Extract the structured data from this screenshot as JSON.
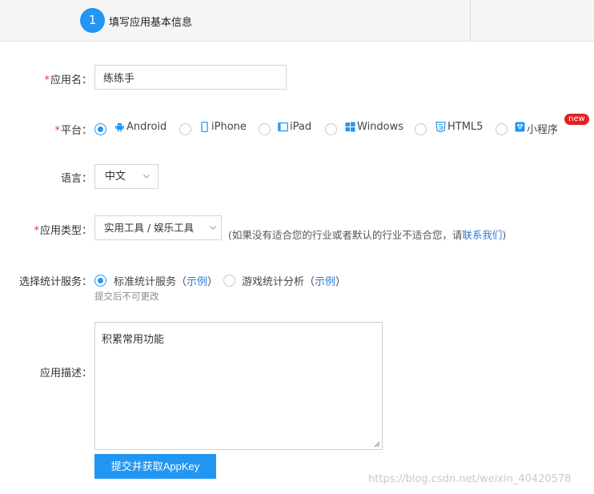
{
  "step": {
    "number": "1",
    "label": "填写应用基本信息"
  },
  "form": {
    "app_name": {
      "label": "应用名：",
      "required_mark": "*",
      "value": "练练手"
    },
    "platform": {
      "label": "平台：",
      "required_mark": "*",
      "options": [
        {
          "label": "Android",
          "icon": "android-icon",
          "checked": true
        },
        {
          "label": "iPhone",
          "icon": "iphone-icon",
          "checked": false
        },
        {
          "label": "iPad",
          "icon": "ipad-icon",
          "checked": false
        },
        {
          "label": "Windows",
          "icon": "windows-icon",
          "checked": false
        },
        {
          "label": "HTML5",
          "icon": "html5-icon",
          "checked": false
        },
        {
          "label": "小程序",
          "icon": "mini-program-icon",
          "checked": false
        }
      ],
      "new_badge": "new"
    },
    "language": {
      "label": "语言：",
      "value": "中文"
    },
    "app_type": {
      "label": "应用类型：",
      "required_mark": "*",
      "value": "实用工具 / 娱乐工具",
      "hint_prefix": "(如果没有适合您的行业或者默认的行业不适合您，请",
      "hint_link": "联系我们",
      "hint_suffix": ")"
    },
    "stat_service": {
      "label": "选择统计服务：",
      "options": [
        {
          "label": "标准统计服务",
          "open": "（",
          "example": "示例",
          "close": "）",
          "checked": true
        },
        {
          "label": "游戏统计分析",
          "open": "（",
          "example": "示例",
          "close": "）",
          "checked": false
        }
      ],
      "note": "提交后不可更改"
    },
    "description": {
      "label": "应用描述：",
      "value": "积累常用功能"
    },
    "submit_label": "提交并获取AppKey"
  },
  "watermark": "https://blog.csdn.net/weixin_40420578",
  "colors": {
    "accent": "#2196f3",
    "required": "#e53935",
    "link": "#2b7cd3",
    "badge": "#e62020"
  }
}
